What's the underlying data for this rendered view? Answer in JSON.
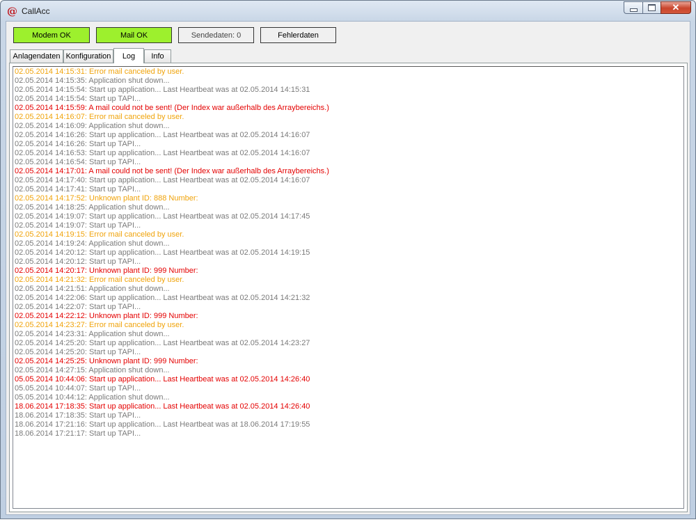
{
  "window": {
    "title": "CallAcc",
    "app_icon": "@"
  },
  "toolbar": {
    "modem_label": "Modem OK",
    "mail_label": "Mail OK",
    "send_label": "Sendedaten: 0",
    "error_label": "Fehlerdaten",
    "ok_color": "#9df02d"
  },
  "tabs": [
    {
      "label": "Anlagendaten"
    },
    {
      "label": "Konfiguration"
    },
    {
      "label": "Log"
    },
    {
      "label": "Info"
    }
  ],
  "log": {
    "colors": {
      "info": "#7a7a7a",
      "warn": "#f0a30a",
      "error": "#e40000"
    },
    "lines": [
      {
        "text": "02.05.2014 14:15:31: Error mail canceled by user.",
        "level": "warn"
      },
      {
        "text": "02.05.2014 14:15:35: Application shut down...",
        "level": "info"
      },
      {
        "text": "02.05.2014 14:15:54: Start up application... Last Heartbeat was at 02.05.2014 14:15:31",
        "level": "info"
      },
      {
        "text": "02.05.2014 14:15:54: Start up TAPI...",
        "level": "info"
      },
      {
        "text": "02.05.2014 14:15:59: A mail could not be sent! (Der Index war außerhalb des Arraybereichs.)",
        "level": "error"
      },
      {
        "text": "02.05.2014 14:16:07: Error mail canceled by user.",
        "level": "warn"
      },
      {
        "text": "02.05.2014 14:16:09: Application shut down...",
        "level": "info"
      },
      {
        "text": "02.05.2014 14:16:26: Start up application... Last Heartbeat was at 02.05.2014 14:16:07",
        "level": "info"
      },
      {
        "text": "02.05.2014 14:16:26: Start up TAPI...",
        "level": "info"
      },
      {
        "text": "02.05.2014 14:16:53: Start up application... Last Heartbeat was at 02.05.2014 14:16:07",
        "level": "info"
      },
      {
        "text": "02.05.2014 14:16:54: Start up TAPI...",
        "level": "info"
      },
      {
        "text": "02.05.2014 14:17:01: A mail could not be sent! (Der Index war außerhalb des Arraybereichs.)",
        "level": "error"
      },
      {
        "text": "02.05.2014 14:17:40: Start up application... Last Heartbeat was at 02.05.2014 14:16:07",
        "level": "info"
      },
      {
        "text": "02.05.2014 14:17:41: Start up TAPI...",
        "level": "info"
      },
      {
        "text": "02.05.2014 14:17:52: Unknown plant ID: 888 Number:",
        "level": "warn"
      },
      {
        "text": "02.05.2014 14:18:25: Application shut down...",
        "level": "info"
      },
      {
        "text": "02.05.2014 14:19:07: Start up application... Last Heartbeat was at 02.05.2014 14:17:45",
        "level": "info"
      },
      {
        "text": "02.05.2014 14:19:07: Start up TAPI...",
        "level": "info"
      },
      {
        "text": "02.05.2014 14:19:15: Error mail canceled by user.",
        "level": "warn"
      },
      {
        "text": "02.05.2014 14:19:24: Application shut down...",
        "level": "info"
      },
      {
        "text": "02.05.2014 14:20:12: Start up application... Last Heartbeat was at 02.05.2014 14:19:15",
        "level": "info"
      },
      {
        "text": "02.05.2014 14:20:12: Start up TAPI...",
        "level": "info"
      },
      {
        "text": "02.05.2014 14:20:17: Unknown plant ID: 999 Number:",
        "level": "error"
      },
      {
        "text": "02.05.2014 14:21:32: Error mail canceled by user.",
        "level": "warn"
      },
      {
        "text": "02.05.2014 14:21:51: Application shut down...",
        "level": "info"
      },
      {
        "text": "02.05.2014 14:22:06: Start up application... Last Heartbeat was at 02.05.2014 14:21:32",
        "level": "info"
      },
      {
        "text": "02.05.2014 14:22:07: Start up TAPI...",
        "level": "info"
      },
      {
        "text": "02.05.2014 14:22:12: Unknown plant ID: 999 Number:",
        "level": "error"
      },
      {
        "text": "02.05.2014 14:23:27: Error mail canceled by user.",
        "level": "warn"
      },
      {
        "text": "02.05.2014 14:23:31: Application shut down...",
        "level": "info"
      },
      {
        "text": "02.05.2014 14:25:20: Start up application... Last Heartbeat was at 02.05.2014 14:23:27",
        "level": "info"
      },
      {
        "text": "02.05.2014 14:25:20: Start up TAPI...",
        "level": "info"
      },
      {
        "text": "02.05.2014 14:25:25: Unknown plant ID: 999 Number:",
        "level": "error"
      },
      {
        "text": "02.05.2014 14:27:15: Application shut down...",
        "level": "info"
      },
      {
        "text": "05.05.2014 10:44:06: Start up application... Last Heartbeat was at 02.05.2014 14:26:40",
        "level": "error"
      },
      {
        "text": "05.05.2014 10:44:07: Start up TAPI...",
        "level": "info"
      },
      {
        "text": "05.05.2014 10:44:12: Application shut down...",
        "level": "info"
      },
      {
        "text": "18.06.2014 17:18:35: Start up application... Last Heartbeat was at 02.05.2014 14:26:40",
        "level": "error"
      },
      {
        "text": "18.06.2014 17:18:35: Start up TAPI...",
        "level": "info"
      },
      {
        "text": "18.06.2014 17:21:16: Start up application... Last Heartbeat was at 18.06.2014 17:19:55",
        "level": "info"
      },
      {
        "text": "18.06.2014 17:21:17: Start up TAPI...",
        "level": "info"
      }
    ]
  }
}
